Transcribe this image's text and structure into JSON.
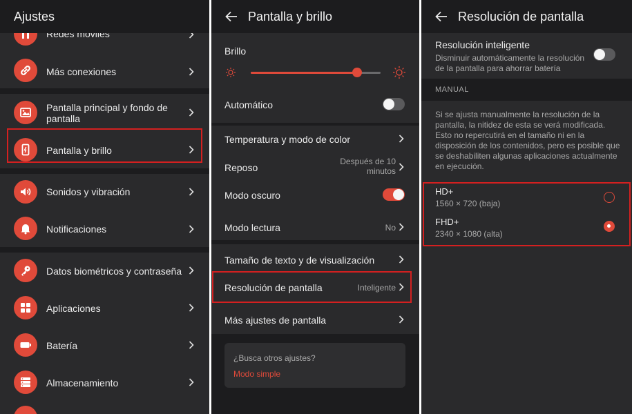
{
  "colors": {
    "accent": "#e04a3a",
    "highlight": "#d42020",
    "background": "#1c1c1e",
    "card": "#2a2a2c"
  },
  "settings": {
    "title": "Ajustes",
    "items": [
      {
        "label": "Redes móviles",
        "icon": "signal-icon"
      },
      {
        "label": "Más conexiones",
        "icon": "link-icon"
      },
      {
        "label": "Pantalla principal y fondo de pantalla",
        "icon": "wallpaper-icon"
      },
      {
        "label": "Pantalla y brillo",
        "icon": "phone-brightness-icon"
      },
      {
        "label": "Sonidos y vibración",
        "icon": "speaker-icon"
      },
      {
        "label": "Notificaciones",
        "icon": "bell-icon"
      },
      {
        "label": "Datos biométricos y contraseña",
        "icon": "key-icon"
      },
      {
        "label": "Aplicaciones",
        "icon": "apps-grid-icon"
      },
      {
        "label": "Batería",
        "icon": "battery-icon"
      },
      {
        "label": "Almacenamiento",
        "icon": "storage-icon"
      }
    ]
  },
  "display": {
    "title": "Pantalla y brillo",
    "brightness_label": "Brillo",
    "brightness_level": 0.82,
    "auto_label": "Automático",
    "auto_on": false,
    "color_temp_label": "Temperatura y modo de color",
    "sleep_label": "Reposo",
    "sleep_value_line1": "Después de 10",
    "sleep_value_line2": "minutos",
    "dark_mode_label": "Modo oscuro",
    "dark_mode_on": true,
    "reading_label": "Modo lectura",
    "reading_value": "No",
    "text_size_label": "Tamaño de texto y de visualización",
    "resolution_label": "Resolución de pantalla",
    "resolution_value": "Inteligente",
    "more_label": "Más ajustes de pantalla",
    "search_prompt": "¿Busca otros ajustes?",
    "simple_mode_link": "Modo simple"
  },
  "resolution": {
    "title": "Resolución de pantalla",
    "smart_label": "Resolución inteligente",
    "smart_desc_line1": "Disminuir automáticamente la resolución",
    "smart_desc_line2": "de la pantalla para ahorrar batería",
    "smart_on": false,
    "manual_header": "MANUAL",
    "manual_desc": [
      "Si se ajusta manualmente la resolución de la",
      "pantalla, la nitidez de esta se verá modificada.",
      "Esto no repercutirá en el tamaño ni en la",
      "disposición de los contenidos, pero es posible que",
      "se deshabiliten algunas aplicaciones actualmente",
      "en ejecución."
    ],
    "options": [
      {
        "label": "HD+",
        "detail": "1560 × 720 (baja)",
        "selected": false
      },
      {
        "label": "FHD+",
        "detail": "2340 × 1080 (alta)",
        "selected": true
      }
    ]
  }
}
